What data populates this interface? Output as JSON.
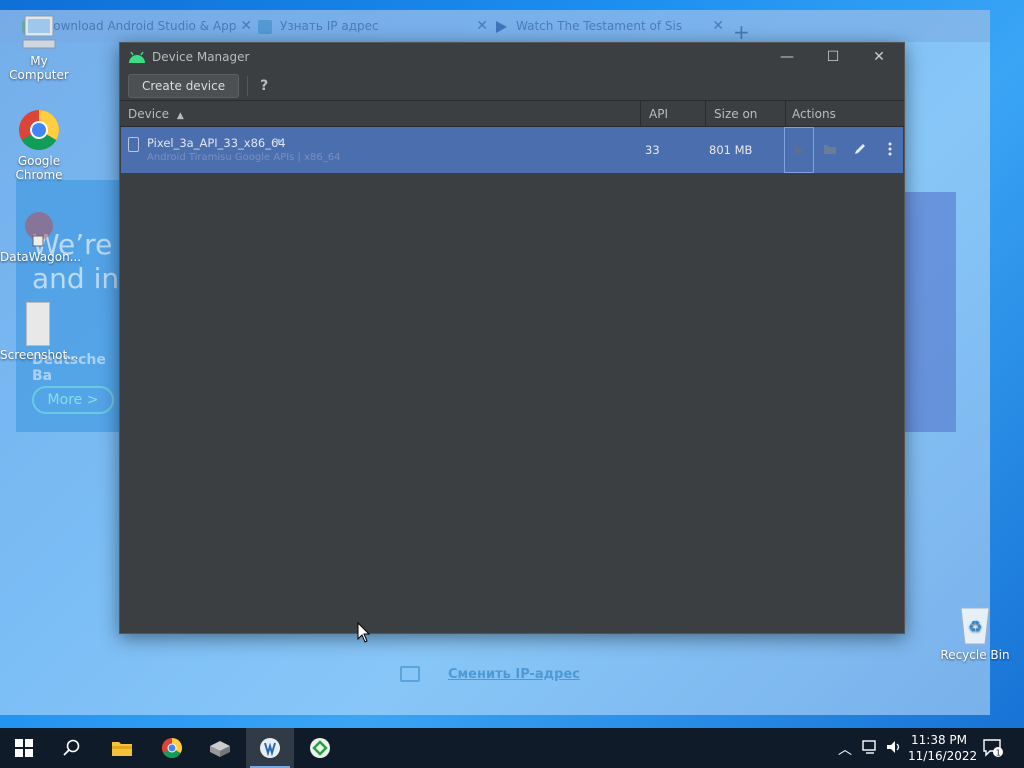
{
  "browser": {
    "tabs": [
      {
        "label": "Download Android Studio & App",
        "close": "✕"
      },
      {
        "label": "Узнать IP адрес",
        "close": "✕"
      },
      {
        "label": "Watch The Testament of Sis",
        "close": "✕"
      }
    ],
    "new_tab": "+",
    "ad": {
      "headline": "We’re and in",
      "brand": "Deutsche Ba",
      "cta": "More >"
    },
    "change_ip_link": "Сменить IP-адрес"
  },
  "desktop": {
    "icons": [
      {
        "label": "My Computer"
      },
      {
        "label": "Google Chrome"
      },
      {
        "label": "DataWagon..."
      },
      {
        "label": "Screenshot..."
      },
      {
        "label": "Recycle Bin"
      }
    ]
  },
  "device_manager": {
    "title": "Device Manager",
    "create_device_label": "Create device",
    "help_label": "?",
    "columns": {
      "device": "Device",
      "api": "API",
      "size": "Size on Disk",
      "actions": "Actions"
    },
    "sort_indicator": "▲",
    "devices": [
      {
        "name": "Pixel_3a_API_33_x86_64",
        "subtitle": "Android Tiramisu Google APIs | x86_64",
        "api": "33",
        "size": "801 MB"
      }
    ]
  },
  "taskbar": {
    "time": "11:38 PM",
    "date": "11/16/2022",
    "notification_count": "1"
  }
}
